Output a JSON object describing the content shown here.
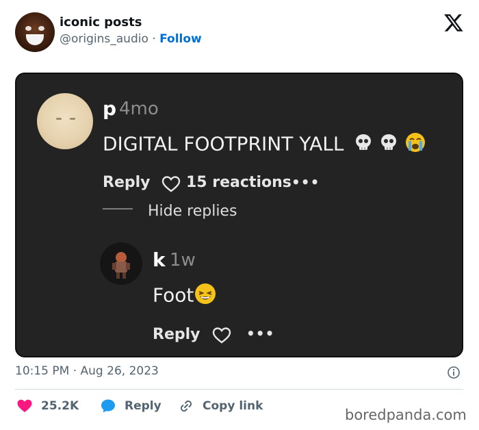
{
  "tweet": {
    "author_name": "iconic posts",
    "author_handle": "@origins_audio",
    "separator": " · ",
    "follow_label": "Follow",
    "timestamp": "10:15 PM · Aug 26, 2023"
  },
  "comments": [
    {
      "username": "p",
      "time": "4mo",
      "text": "DIGITAL FOOTPRINT YALL",
      "emojis": [
        "skull-emoji",
        "skull-emoji",
        "loudly-crying-emoji"
      ],
      "reply_label": "Reply",
      "reactions_label": "15 reactions",
      "hide_replies_label": "Hide replies"
    },
    {
      "username": "k",
      "time": "1w",
      "text": "Foot",
      "emojis": [
        "grinning-squinting-emoji"
      ],
      "reply_label": "Reply"
    }
  ],
  "footer": {
    "likes": "25.2K",
    "reply_label": "Reply",
    "copy_link_label": "Copy link"
  },
  "watermark": "boredpanda.com",
  "colors": {
    "follow_blue": "#006fd6",
    "like_pink": "#f91880",
    "reply_blue": "#1d9bf0",
    "media_bg": "#232323"
  }
}
